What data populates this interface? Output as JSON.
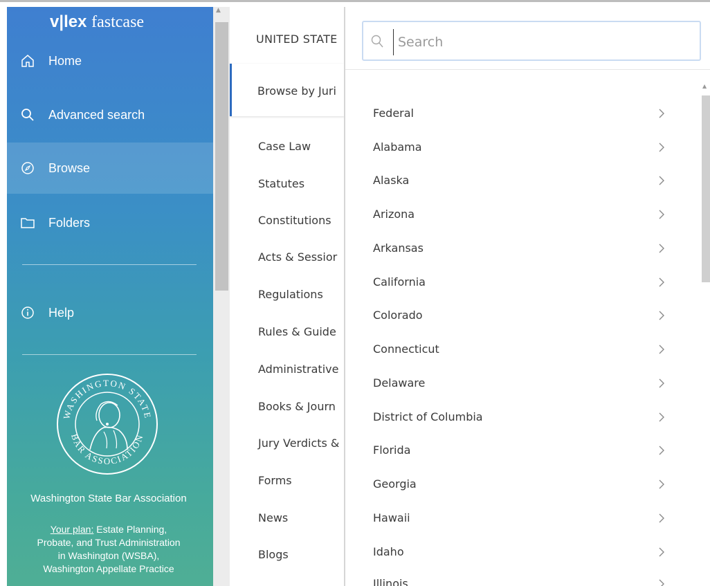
{
  "brand": {
    "logo_prefix": "v|lex",
    "logo_suffix": "fastcase"
  },
  "sidebar": {
    "items": [
      {
        "label": "Home",
        "icon": "home-icon"
      },
      {
        "label": "Advanced search",
        "icon": "search-icon"
      },
      {
        "label": "Browse",
        "icon": "compass-icon",
        "active": true
      },
      {
        "label": "Folders",
        "icon": "folder-icon"
      },
      {
        "label": "Help",
        "icon": "info-icon"
      }
    ],
    "seal_text_top": "WASHINGTON STATE",
    "seal_text_bottom": "BAR ASSOCIATION",
    "org_name": "Washington State Bar Association",
    "plan_label": "Your plan:",
    "plan_line1": " Estate Planning,",
    "plan_line2": "Probate, and Trust Administration",
    "plan_line3": "in Washington (WSBA),",
    "plan_line4": "Washington Appellate Practice"
  },
  "middle": {
    "title": "UNITED STATE",
    "browse_label": "Browse by Juri",
    "items": [
      "Case Law",
      "Statutes",
      "Constitutions",
      "Acts & Sessior",
      "Regulations",
      "Rules & Guide",
      "Administrative",
      "Books & Journ",
      "Jury Verdicts &",
      "Forms",
      "News",
      "Blogs"
    ]
  },
  "search": {
    "placeholder": "Search",
    "value": ""
  },
  "jurisdictions": [
    "Federal",
    "Alabama",
    "Alaska",
    "Arizona",
    "Arkansas",
    "California",
    "Colorado",
    "Connecticut",
    "Delaware",
    "District of Columbia",
    "Florida",
    "Georgia",
    "Hawaii",
    "Idaho",
    "Illinois"
  ],
  "colors": {
    "sidebar_top": "#3f7fd0",
    "sidebar_bottom": "#4fae95",
    "active_border": "#2d6bbf",
    "search_border": "#c9dbf2"
  }
}
